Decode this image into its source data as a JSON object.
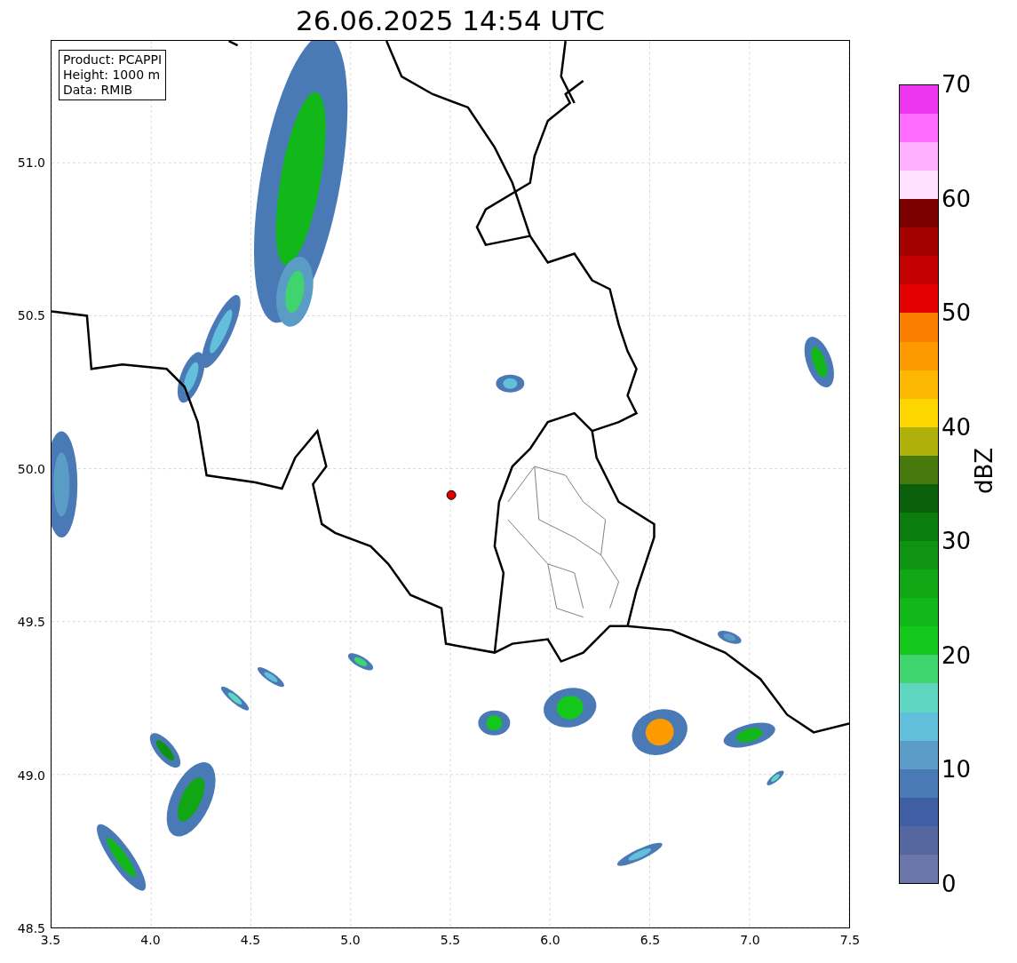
{
  "title": "26.06.2025 14:54 UTC",
  "map": {
    "info": [
      "Product: PCAPPI",
      "Height: 1000 m",
      "Data: RMIB"
    ],
    "x_ticks": [
      "3.5",
      "4.0",
      "4.5",
      "5.0",
      "5.5",
      "6.0",
      "6.5",
      "7.0",
      "7.5"
    ],
    "y_ticks": [
      "51.0",
      "50.5",
      "50.0",
      "49.5",
      "49.0",
      "48.5"
    ]
  },
  "colorbar": {
    "label": "dBZ",
    "ticks": [
      "70",
      "60",
      "50",
      "40",
      "30",
      "20",
      "10",
      "0"
    ],
    "bins": [
      {
        "color": "#6a75a8"
      },
      {
        "color": "#56669e"
      },
      {
        "color": "#3f5ea4"
      },
      {
        "color": "#4a7ab5"
      },
      {
        "color": "#5b9cc6"
      },
      {
        "color": "#63c0dc"
      },
      {
        "color": "#5fd6c0"
      },
      {
        "color": "#3fd46e"
      },
      {
        "color": "#13c81a"
      },
      {
        "color": "#12b81a"
      },
      {
        "color": "#10a614"
      },
      {
        "color": "#0e9312"
      },
      {
        "color": "#0b7c0e"
      },
      {
        "color": "#0a5f0a"
      },
      {
        "color": "#477a0d"
      },
      {
        "color": "#b0b00a"
      },
      {
        "color": "#fdd600"
      },
      {
        "color": "#fcb800"
      },
      {
        "color": "#fc9a00"
      },
      {
        "color": "#fc7e00"
      },
      {
        "color": "#e40000"
      },
      {
        "color": "#c40000"
      },
      {
        "color": "#a40000"
      },
      {
        "color": "#7a0000"
      },
      {
        "color": "#ffe0ff"
      },
      {
        "color": "#ffb0ff"
      },
      {
        "color": "#ff6cff"
      },
      {
        "color": "#ee35ee"
      }
    ]
  }
}
